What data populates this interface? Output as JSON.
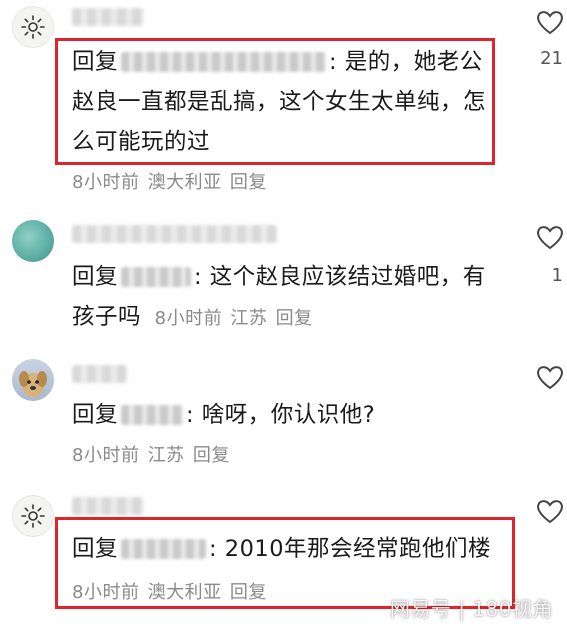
{
  "comments": [
    {
      "reply_prefix": "回复",
      "text": ": 是的，她老公赵良一直都是乱搞，这个女生太单纯，怎么可能玩的过",
      "time": "8小时前",
      "location": "澳大利亚",
      "reply_label": "回复",
      "likes": "21"
    },
    {
      "reply_prefix": "回复",
      "text": ": 这个赵良应该结过婚吧，有孩子吗",
      "time": "8小时前",
      "location": "江苏",
      "reply_label": "回复",
      "likes": "1"
    },
    {
      "reply_prefix": "回复",
      "text": ": 啥呀，你认识他?",
      "time": "8小时前",
      "location": "江苏",
      "reply_label": "回复",
      "likes": ""
    },
    {
      "reply_prefix": "回复",
      "text": ": 2010年那会经常跑他们楼",
      "time": "8小时前",
      "location": "澳大利亚",
      "reply_label": "回复",
      "likes": ""
    }
  ],
  "watermark": "网易号 | 180视角",
  "colors": {
    "highlight_box": "#e0242b",
    "meta_text": "#8a8a8a",
    "body_text": "#1a1a1a"
  },
  "icons": {
    "like": "heart-outline-icon",
    "avatar_default": "sun-icon"
  }
}
